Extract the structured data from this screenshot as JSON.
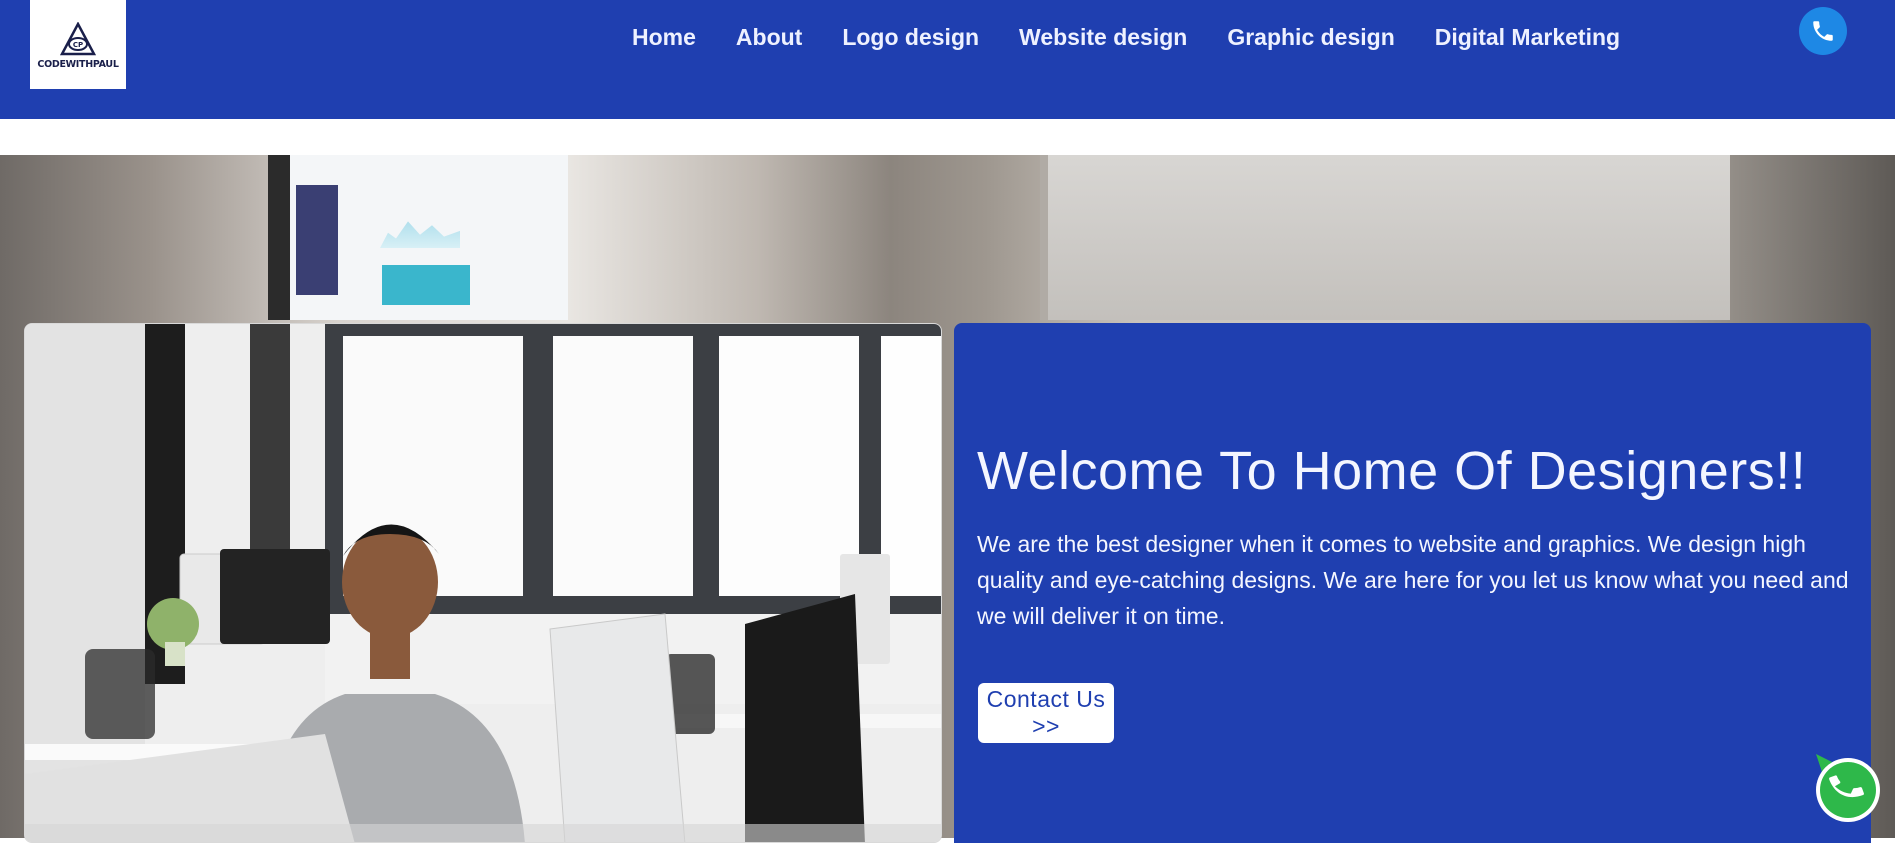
{
  "brand": {
    "logo_text": "CODEWITHPAUL"
  },
  "nav": {
    "items": [
      {
        "label": "Home"
      },
      {
        "label": "About"
      },
      {
        "label": "Logo design"
      },
      {
        "label": "Website design"
      },
      {
        "label": "Graphic design"
      },
      {
        "label": "Digital Marketing"
      }
    ]
  },
  "header": {
    "phone_icon": "phone-icon"
  },
  "hero": {
    "title": "Welcome To Home Of Designers!!",
    "description": "We are the best designer when it comes to website and graphics. We design high quality and eye-catching designs. We are here for you let us know what you need and we will deliver it on time.",
    "cta_label": "Contact Us >>"
  },
  "floating": {
    "call_icon": "whatsapp-call-icon"
  },
  "colors": {
    "primary": "#1f3fb0",
    "phone_button": "#1e88e5",
    "whatsapp": "#2eb84a"
  }
}
